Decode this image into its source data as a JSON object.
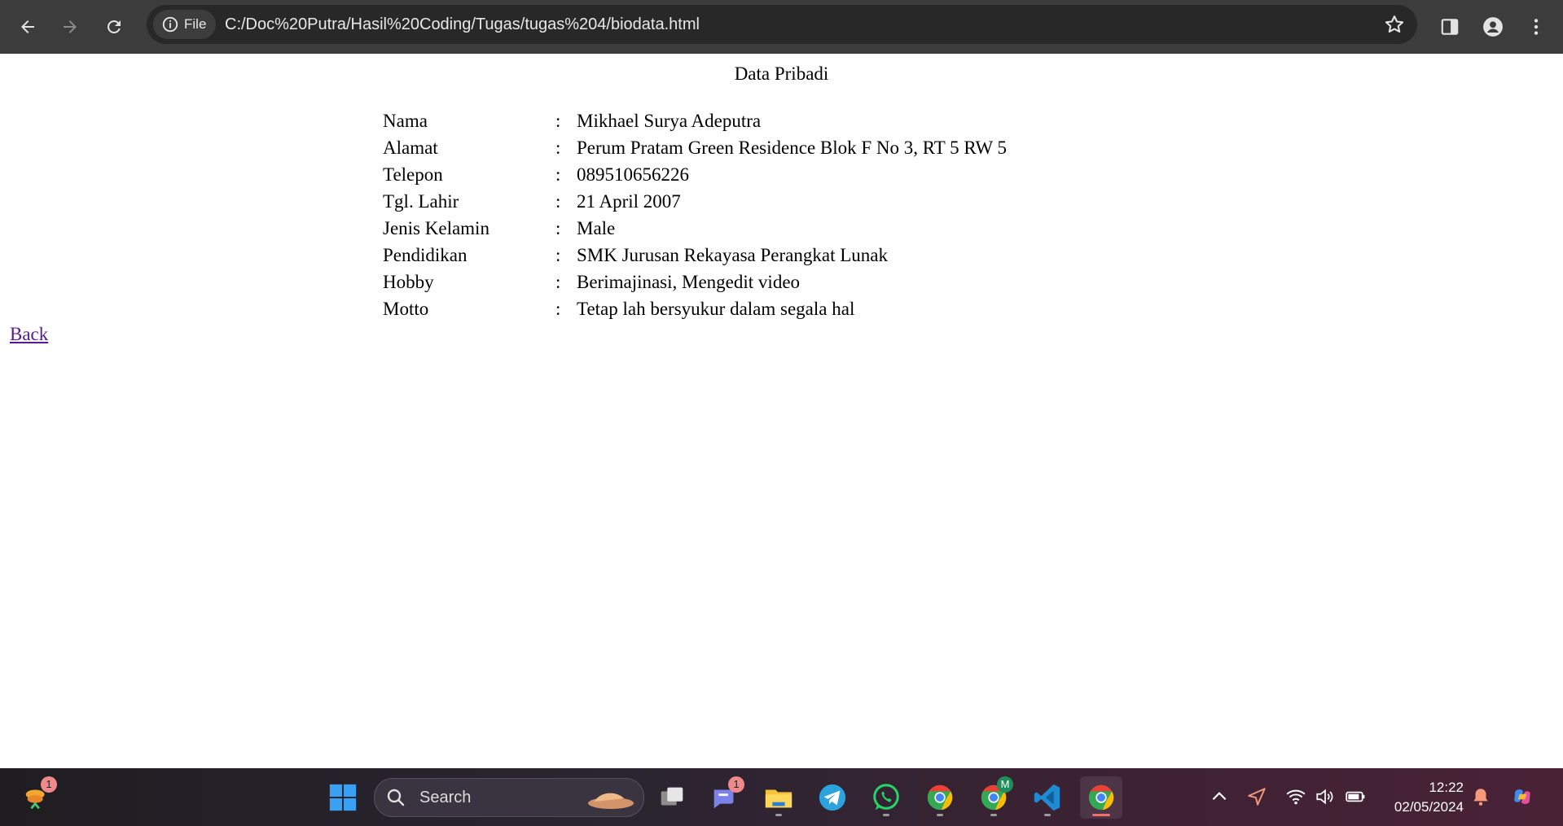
{
  "browser": {
    "url_scheme_label": "File",
    "url": "C:/Doc%20Putra/Hasil%20Coding/Tugas/tugas%204/biodata.html"
  },
  "page": {
    "title": "Data Pribadi",
    "separator": ":",
    "rows": [
      {
        "label": "Nama",
        "value": "Mikhael Surya Adeputra"
      },
      {
        "label": "Alamat",
        "value": "Perum Pratam Green Residence Blok F No 3, RT 5 RW 5"
      },
      {
        "label": "Telepon",
        "value": "089510656226"
      },
      {
        "label": "Tgl. Lahir",
        "value": "21 April 2007"
      },
      {
        "label": "Jenis Kelamin",
        "value": "Male"
      },
      {
        "label": "Pendidikan",
        "value": "SMK Jurusan Rekayasa Perangkat Lunak"
      },
      {
        "label": "Hobby",
        "value": "Berimajinasi, Mengedit video"
      },
      {
        "label": "Motto",
        "value": "Tetap lah bersyukur dalam segala hal"
      }
    ],
    "back_link": "Back"
  },
  "taskbar": {
    "widgets_badge": "1",
    "search_placeholder": "Search",
    "teams_badge": "1",
    "chrome_profile_badge": "M",
    "time": "12:22",
    "date": "02/05/2024"
  },
  "colors": {
    "link_visited": "#551a8b",
    "toolbar_bg": "#3c3c3c",
    "omnibox_bg": "#282828"
  }
}
